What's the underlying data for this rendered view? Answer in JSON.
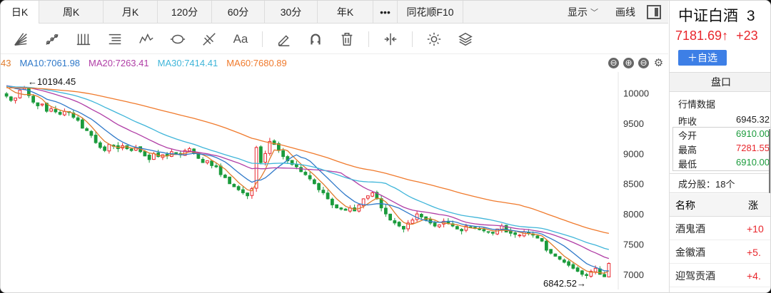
{
  "tabs": [
    {
      "label": "日K",
      "active": true
    },
    {
      "label": "周K"
    },
    {
      "label": "月K"
    },
    {
      "label": "120分"
    },
    {
      "label": "60分"
    },
    {
      "label": "30分"
    },
    {
      "label": "年K"
    },
    {
      "label": "•••"
    },
    {
      "label": "同花顺F10"
    }
  ],
  "tab_right": {
    "display": "显示",
    "chevron": "﹀",
    "draw": "画线"
  },
  "toolbar_icons": [
    "fan-icon",
    "trend-line-icon",
    "vertical-lines-icon",
    "text-list-icon",
    "wave-icon",
    "ellipse-icon",
    "fork-icon",
    "text-aa-icon",
    "pen-icon",
    "magnet-icon",
    "trash-icon",
    "split-icon",
    "gear-icon",
    "layers-icon"
  ],
  "toolbar_text": {
    "aa": "Aa"
  },
  "ma_legend": {
    "ma5": {
      "label": "43",
      "color": "#e07b2b"
    },
    "ma10": {
      "label": "MA10:7061.98",
      "color": "#2f79c9"
    },
    "ma20": {
      "label": "MA20:7263.41",
      "color": "#b03ea6"
    },
    "ma30": {
      "label": "MA30:7414.41",
      "color": "#3fb5d9"
    },
    "ma60": {
      "label": "MA60:7680.89",
      "color": "#f07a2c"
    },
    "controls": [
      "⊖",
      "⊕",
      "⊖",
      "⚙"
    ]
  },
  "chart_data": {
    "type": "candlestick",
    "ylim": [
      6750,
      10350
    ],
    "yticks": [
      "10000",
      "9500",
      "9000",
      "8500",
      "8000",
      "7500",
      "7000"
    ],
    "ytick_values": [
      10000,
      9500,
      9000,
      8500,
      8000,
      7500,
      7000
    ],
    "high_label": "←10194.45",
    "low_label": "6842.52→",
    "high_value": 10194.45,
    "low_value": 6842.52,
    "up_color": "#e8262c",
    "down_color": "#1b9b3c",
    "closes": [
      9950,
      9880,
      9920,
      10050,
      10080,
      9960,
      9850,
      9790,
      9820,
      9700,
      9740,
      9690,
      9650,
      9700,
      9680,
      9600,
      9550,
      9420,
      9380,
      9300,
      9180,
      9100,
      9050,
      9150,
      9120,
      9080,
      9130,
      9080,
      9050,
      9100,
      9030,
      8960,
      8900,
      9000,
      8950,
      8980,
      8960,
      9030,
      9000,
      8980,
      9050,
      9080,
      9000,
      8920,
      8850,
      8880,
      8800,
      8780,
      8650,
      8600,
      8500,
      8450,
      8400,
      8350,
      8300,
      8420,
      9100,
      8850,
      9000,
      9200,
      9150,
      9050,
      8950,
      8880,
      8820,
      8780,
      8700,
      8650,
      8580,
      8500,
      8400,
      8350,
      8250,
      8150,
      8100,
      8080,
      8060,
      8100,
      8050,
      8150,
      8250,
      8300,
      8350,
      8250,
      8100,
      8000,
      7900,
      7850,
      7800,
      7750,
      7850,
      7900,
      8000,
      7950,
      7900,
      7850,
      7800,
      7820,
      7880,
      7850,
      7800,
      7750,
      7720,
      7800,
      7780,
      7760,
      7740,
      7720,
      7700,
      7680,
      7750,
      7800,
      7700,
      7680,
      7660,
      7650,
      7700,
      7680,
      7650,
      7600,
      7550,
      7400,
      7350,
      7300,
      7250,
      7200,
      7150,
      7100,
      7050,
      7000,
      6980,
      7050,
      7100,
      7000,
      6960,
      7181
    ]
  },
  "right_panel": {
    "name": "中证白酒",
    "name_suffix": "3",
    "price": "7181.69↑",
    "change": "+23",
    "add_button": "＋自选",
    "tab": "盘口",
    "section": "行情数据",
    "prev_close": {
      "label": "昨收",
      "value": "6945.32"
    },
    "open": {
      "label": "今开",
      "value": "6910.00"
    },
    "high": {
      "label": "最高",
      "value": "7281.55"
    },
    "low": {
      "label": "最低",
      "value": "6910.00"
    },
    "constituents": "成分股：18个",
    "col_name": "名称",
    "col_change": "涨",
    "rows": [
      {
        "name": "酒鬼酒",
        "change": "+10"
      },
      {
        "name": "金徽酒",
        "change": "+5."
      },
      {
        "name": "迎驾贡酒",
        "change": "+4."
      }
    ]
  }
}
